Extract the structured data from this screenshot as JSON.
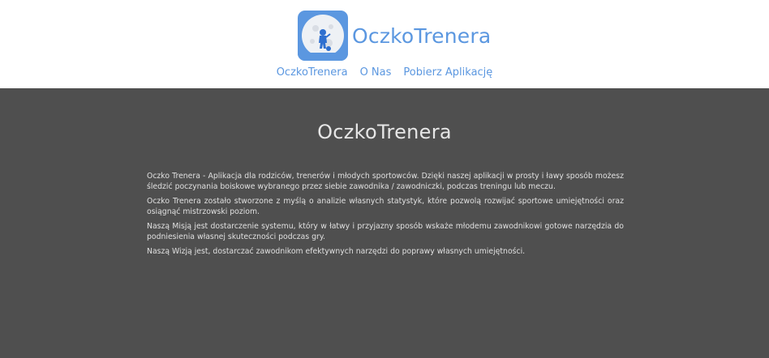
{
  "header": {
    "brand": "OczkoTrenera",
    "logo_icon": "moon-child-logo-icon",
    "colors": {
      "accent": "#5b97e0",
      "background": "#ffffff"
    }
  },
  "nav": {
    "items": [
      {
        "label": "OczkoTrenera"
      },
      {
        "label": "O Nas"
      },
      {
        "label": "Pobierz Aplikację"
      }
    ]
  },
  "main": {
    "title": "OczkoTrenera",
    "colors": {
      "background": "#4f4f4f",
      "text": "#e0e0e0"
    },
    "paragraphs": [
      "Oczko Trenera - Aplikacja dla rodziców, trenerów i młodych sportowców. Dzięki naszej aplikacji w prosty i ławy sposób możesz śledzić poczynania boiskowe wybranego przez siebie zawodnika / zawodniczki, podczas treningu lub meczu.",
      "Oczko Trenera zostało stworzone z myślą o analizie własnych statystyk, które pozwolą rozwijać sportowe umiejętności oraz osiągnąć mistrzowski poziom.",
      "Naszą Misją jest dostarczenie systemu, który w łatwy i przyjazny sposób wskaże młodemu zawodnikowi gotowe narzędzia do podniesienia własnej skuteczności podczas gry.",
      "Naszą Wizją jest, dostarczać zawodnikom efektywnych narzędzi do poprawy własnych umiejętności."
    ]
  }
}
